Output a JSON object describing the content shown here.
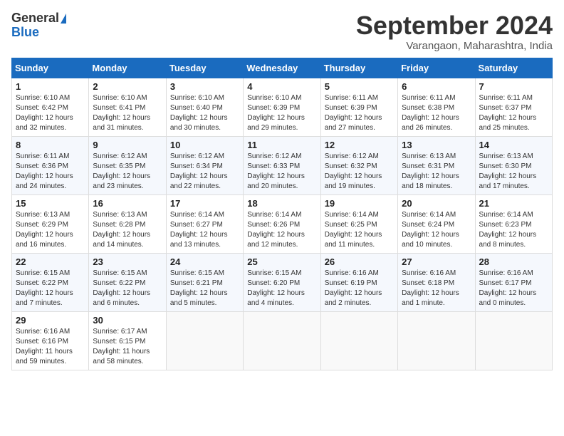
{
  "logo": {
    "general": "General",
    "blue": "Blue"
  },
  "title": {
    "month_year": "September 2024",
    "location": "Varangaon, Maharashtra, India"
  },
  "weekdays": [
    "Sunday",
    "Monday",
    "Tuesday",
    "Wednesday",
    "Thursday",
    "Friday",
    "Saturday"
  ],
  "weeks": [
    [
      {
        "day": 1,
        "sunrise": "6:10 AM",
        "sunset": "6:42 PM",
        "daylight": "12 hours and 32 minutes."
      },
      {
        "day": 2,
        "sunrise": "6:10 AM",
        "sunset": "6:41 PM",
        "daylight": "12 hours and 31 minutes."
      },
      {
        "day": 3,
        "sunrise": "6:10 AM",
        "sunset": "6:40 PM",
        "daylight": "12 hours and 30 minutes."
      },
      {
        "day": 4,
        "sunrise": "6:10 AM",
        "sunset": "6:39 PM",
        "daylight": "12 hours and 29 minutes."
      },
      {
        "day": 5,
        "sunrise": "6:11 AM",
        "sunset": "6:39 PM",
        "daylight": "12 hours and 27 minutes."
      },
      {
        "day": 6,
        "sunrise": "6:11 AM",
        "sunset": "6:38 PM",
        "daylight": "12 hours and 26 minutes."
      },
      {
        "day": 7,
        "sunrise": "6:11 AM",
        "sunset": "6:37 PM",
        "daylight": "12 hours and 25 minutes."
      }
    ],
    [
      {
        "day": 8,
        "sunrise": "6:11 AM",
        "sunset": "6:36 PM",
        "daylight": "12 hours and 24 minutes."
      },
      {
        "day": 9,
        "sunrise": "6:12 AM",
        "sunset": "6:35 PM",
        "daylight": "12 hours and 23 minutes."
      },
      {
        "day": 10,
        "sunrise": "6:12 AM",
        "sunset": "6:34 PM",
        "daylight": "12 hours and 22 minutes."
      },
      {
        "day": 11,
        "sunrise": "6:12 AM",
        "sunset": "6:33 PM",
        "daylight": "12 hours and 20 minutes."
      },
      {
        "day": 12,
        "sunrise": "6:12 AM",
        "sunset": "6:32 PM",
        "daylight": "12 hours and 19 minutes."
      },
      {
        "day": 13,
        "sunrise": "6:13 AM",
        "sunset": "6:31 PM",
        "daylight": "12 hours and 18 minutes."
      },
      {
        "day": 14,
        "sunrise": "6:13 AM",
        "sunset": "6:30 PM",
        "daylight": "12 hours and 17 minutes."
      }
    ],
    [
      {
        "day": 15,
        "sunrise": "6:13 AM",
        "sunset": "6:29 PM",
        "daylight": "12 hours and 16 minutes."
      },
      {
        "day": 16,
        "sunrise": "6:13 AM",
        "sunset": "6:28 PM",
        "daylight": "12 hours and 14 minutes."
      },
      {
        "day": 17,
        "sunrise": "6:14 AM",
        "sunset": "6:27 PM",
        "daylight": "12 hours and 13 minutes."
      },
      {
        "day": 18,
        "sunrise": "6:14 AM",
        "sunset": "6:26 PM",
        "daylight": "12 hours and 12 minutes."
      },
      {
        "day": 19,
        "sunrise": "6:14 AM",
        "sunset": "6:25 PM",
        "daylight": "12 hours and 11 minutes."
      },
      {
        "day": 20,
        "sunrise": "6:14 AM",
        "sunset": "6:24 PM",
        "daylight": "12 hours and 10 minutes."
      },
      {
        "day": 21,
        "sunrise": "6:14 AM",
        "sunset": "6:23 PM",
        "daylight": "12 hours and 8 minutes."
      }
    ],
    [
      {
        "day": 22,
        "sunrise": "6:15 AM",
        "sunset": "6:22 PM",
        "daylight": "12 hours and 7 minutes."
      },
      {
        "day": 23,
        "sunrise": "6:15 AM",
        "sunset": "6:22 PM",
        "daylight": "12 hours and 6 minutes."
      },
      {
        "day": 24,
        "sunrise": "6:15 AM",
        "sunset": "6:21 PM",
        "daylight": "12 hours and 5 minutes."
      },
      {
        "day": 25,
        "sunrise": "6:15 AM",
        "sunset": "6:20 PM",
        "daylight": "12 hours and 4 minutes."
      },
      {
        "day": 26,
        "sunrise": "6:16 AM",
        "sunset": "6:19 PM",
        "daylight": "12 hours and 2 minutes."
      },
      {
        "day": 27,
        "sunrise": "6:16 AM",
        "sunset": "6:18 PM",
        "daylight": "12 hours and 1 minute."
      },
      {
        "day": 28,
        "sunrise": "6:16 AM",
        "sunset": "6:17 PM",
        "daylight": "12 hours and 0 minutes."
      }
    ],
    [
      {
        "day": 29,
        "sunrise": "6:16 AM",
        "sunset": "6:16 PM",
        "daylight": "11 hours and 59 minutes."
      },
      {
        "day": 30,
        "sunrise": "6:17 AM",
        "sunset": "6:15 PM",
        "daylight": "11 hours and 58 minutes."
      },
      null,
      null,
      null,
      null,
      null
    ]
  ]
}
